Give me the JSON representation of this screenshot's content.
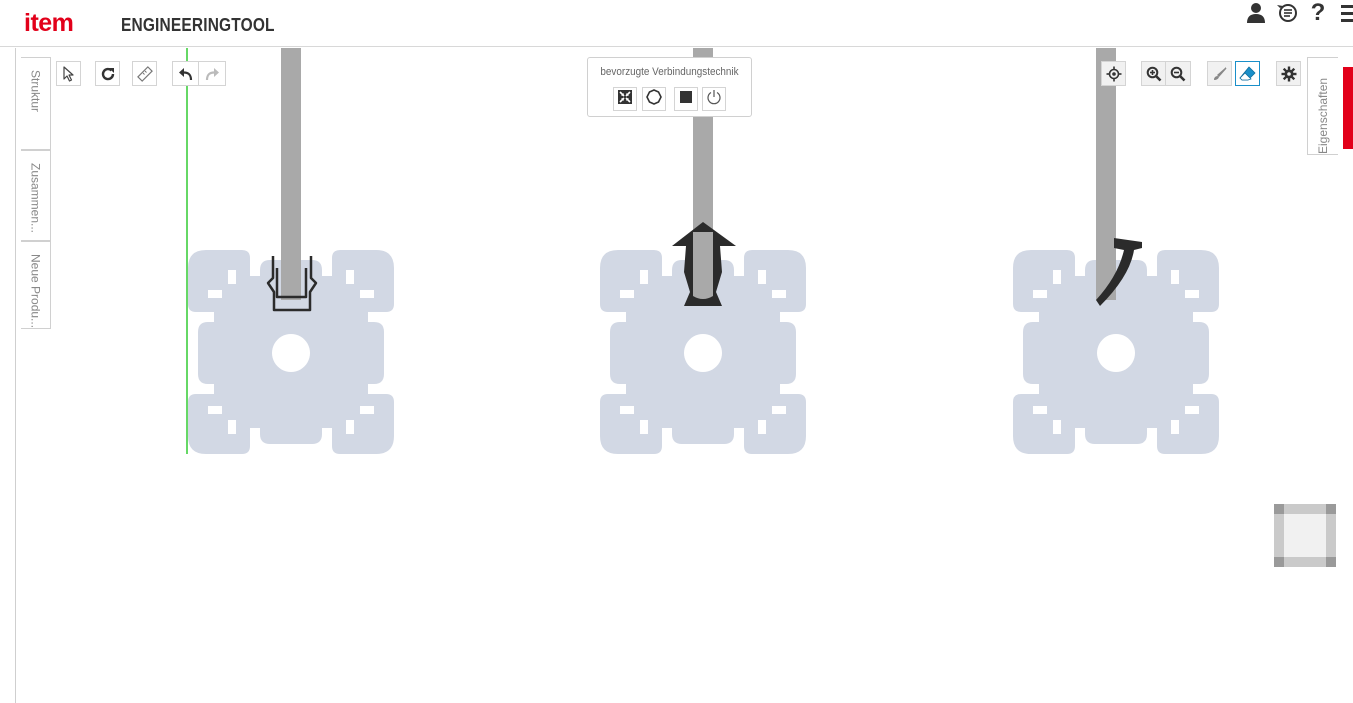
{
  "header": {
    "logo": "item",
    "title": "ENGINEERINGTOOL",
    "icons": [
      "user-icon",
      "speech-bubble-icon",
      "help-icon",
      "menu-icon"
    ],
    "help_glyph": "?"
  },
  "left_panel": {
    "tabs": [
      {
        "label": "Struktur"
      },
      {
        "label": "Zusammen..."
      },
      {
        "label": "Neue Produ..."
      }
    ]
  },
  "right_panel": {
    "tab_label": "Eigenschaften"
  },
  "toolbar_left": [
    "select-cursor-icon",
    "rotate-icon",
    "measure-ruler-icon",
    "undo-icon",
    "redo-icon"
  ],
  "toolbar_right": [
    "center-view-icon",
    "zoom-in-icon",
    "zoom-out-icon",
    "paint-brush-icon",
    "eraser-icon",
    "settings-gear-icon"
  ],
  "connection_panel": {
    "title": "bevorzugte Verbindungstechnik",
    "options": [
      "shrink-arrows-icon",
      "circle-outline-icon",
      "filled-square-icon",
      "power-icon"
    ]
  },
  "colors": {
    "brand_red": "#e2001a",
    "profile_fill": "#d2d8e4",
    "rod_grey": "#a9a9a9",
    "seal_dark": "#2b2b2b",
    "axis_y": "#33cc33",
    "axis_x_start": "#e33",
    "axis_x_end": "#f0a020",
    "active_accent": "#1a8fc9"
  },
  "scene": {
    "profiles": 3,
    "seal_types": [
      "u-clip-seal",
      "arrow-lip-seal",
      "hook-lip-seal"
    ]
  }
}
